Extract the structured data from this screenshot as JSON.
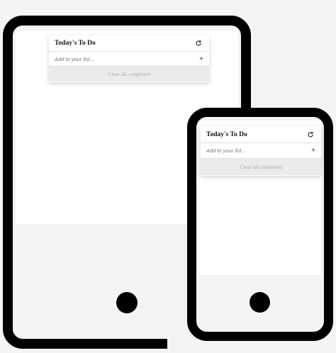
{
  "colors": {
    "background": "#f4f4f4",
    "device_frame": "#000000",
    "screen": "#ffffff",
    "clear_bar": "#ebebeb",
    "clear_text": "#aaaaaa"
  },
  "tablet": {
    "todo": {
      "title": "Today's To Do",
      "refresh_icon": "refresh-icon",
      "input_placeholder": "Add to your list...",
      "add_icon": "+",
      "clear_label": "Clear all completed"
    }
  },
  "phone": {
    "todo": {
      "title": "Today's To Do",
      "refresh_icon": "refresh-icon",
      "input_placeholder": "Add to your list...",
      "add_icon": "+",
      "clear_label": "Clear all completed"
    }
  }
}
